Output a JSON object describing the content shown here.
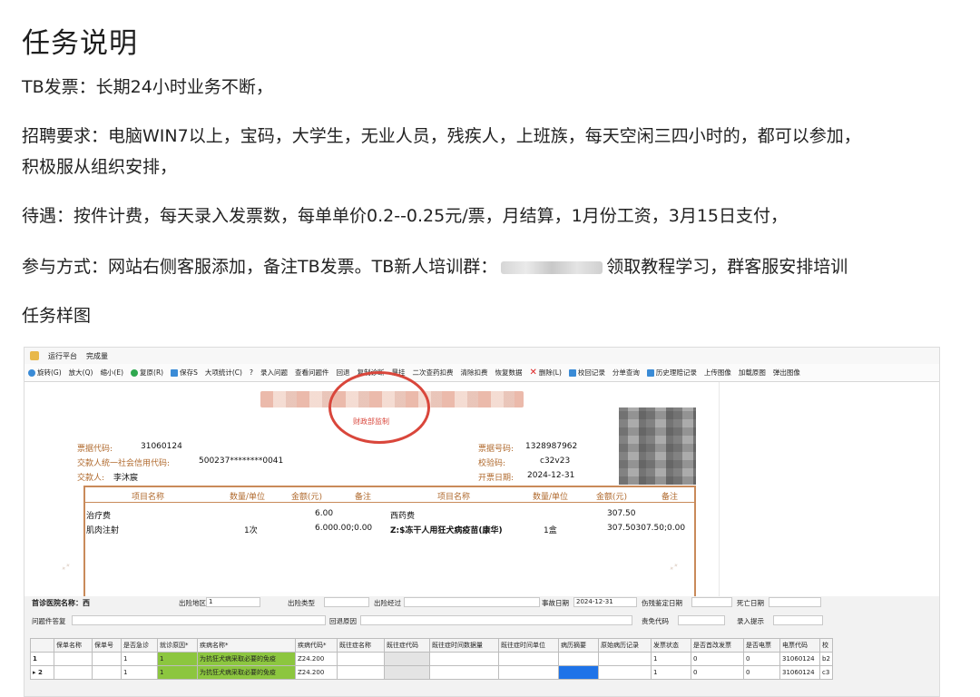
{
  "article": {
    "title": "任务说明",
    "p1": "TB发票：长期24小时业务不断，",
    "p2_line1": "招聘要求：电脑WIN7以上，宝码，大学生，无业人员，残疾人，上班族，每天空闲三四小时的，都可以参加，",
    "p2_line2": "积极服从组织安排，",
    "p3": "待遇：按件计费，每天录入发票数，每单单价0.2--0.25元/票，月结算，1月份工资，3月15日支付，",
    "p4_before": "参与方式：网站右侧客服添加，备注TB发票。TB新人培训群：",
    "p4_after": "领取教程学习，群客服安排培训",
    "p5": "任务样图"
  },
  "screenshot": {
    "menu": [
      "运行平台",
      "完成量"
    ],
    "toolbar": [
      "旋转(G)",
      "放大(Q)",
      "缩小(E)",
      "复原(R)",
      "保存S",
      "大项统计(C)",
      "?",
      "录入问题",
      "查看问题件",
      "回退",
      "复制诊断",
      "暴挂",
      "二次查药扣费",
      "清除扣费",
      "恢复数据",
      "删除(L)",
      "校回记录",
      "分单查询",
      "历史理赔记录",
      "上传图像",
      "加载原图",
      "弹出图像"
    ],
    "invoice": {
      "seal_text": "财政部监制",
      "bill_code_label": "票据代码:",
      "bill_code": "31060124",
      "payer_id_label": "交款人统一社会信用代码:",
      "payer_id": "500237********0041",
      "payer_label": "交款人:",
      "payer": "李沐宸",
      "bill_no_label": "票据号码:",
      "bill_no": "1328987962",
      "check_code_label": "校验码:",
      "check_code": "c32v23",
      "date_label": "开票日期:",
      "date": "2024-12-31",
      "headers": [
        "项目名称",
        "数量/单位",
        "金额(元)",
        "备注",
        "项目名称",
        "数量/单位",
        "金额(元)",
        "备注"
      ],
      "rows": [
        {
          "name": "治疗费",
          "qty": "",
          "amount": "6.00",
          "note": "",
          "name2": "西药费",
          "qty2": "",
          "amount2": "307.50",
          "note2": ""
        },
        {
          "name": "肌肉注射",
          "qty": "1次",
          "amount": "6.000.00;0.00",
          "note": "",
          "name2": "Z:$冻干人用狂犬病疫苗(康华)",
          "qty2": "1盒",
          "amount2": "307.50307.50;0.00",
          "note2": ""
        }
      ]
    },
    "form": {
      "row1_labels": [
        "出险地区",
        "出险类型",
        "出险经过",
        "事故日期",
        "伤残鉴定日期",
        "死亡日期"
      ],
      "row1_values": [
        "1",
        "",
        "",
        "2024-12-31",
        "",
        ""
      ],
      "row1_partial": "首诊医院名称：西",
      "row2_labels": [
        "问题件答复",
        "回退原因",
        "责免代码",
        "录入提示"
      ],
      "grid_headers": [
        "",
        "保单名称",
        "保单号",
        "是否急诊",
        "就诊原因*",
        "疾病名称*",
        "疾病代码*",
        "既往症名称",
        "既往症代码",
        "既往症时间数据量",
        "既往症时间单位",
        "病历摘要",
        "原始病历记录",
        "发票状态",
        "是否首改发票",
        "是否电票",
        "电票代码",
        "校"
      ],
      "grid_rows": [
        [
          "1",
          "",
          "",
          "1",
          "1",
          "为抗狂犬病采取必要的免疫",
          "Z24.200",
          "",
          "",
          "",
          "",
          "",
          "",
          "1",
          "0",
          "0",
          "31060124",
          "b2"
        ],
        [
          "▸ 2",
          "",
          "",
          "1",
          "1",
          "为抗狂犬病采取必要的免疫",
          "Z24.200",
          "",
          "",
          "",
          "",
          "",
          "",
          "1",
          "0",
          "0",
          "31060124",
          "c3"
        ]
      ]
    }
  }
}
